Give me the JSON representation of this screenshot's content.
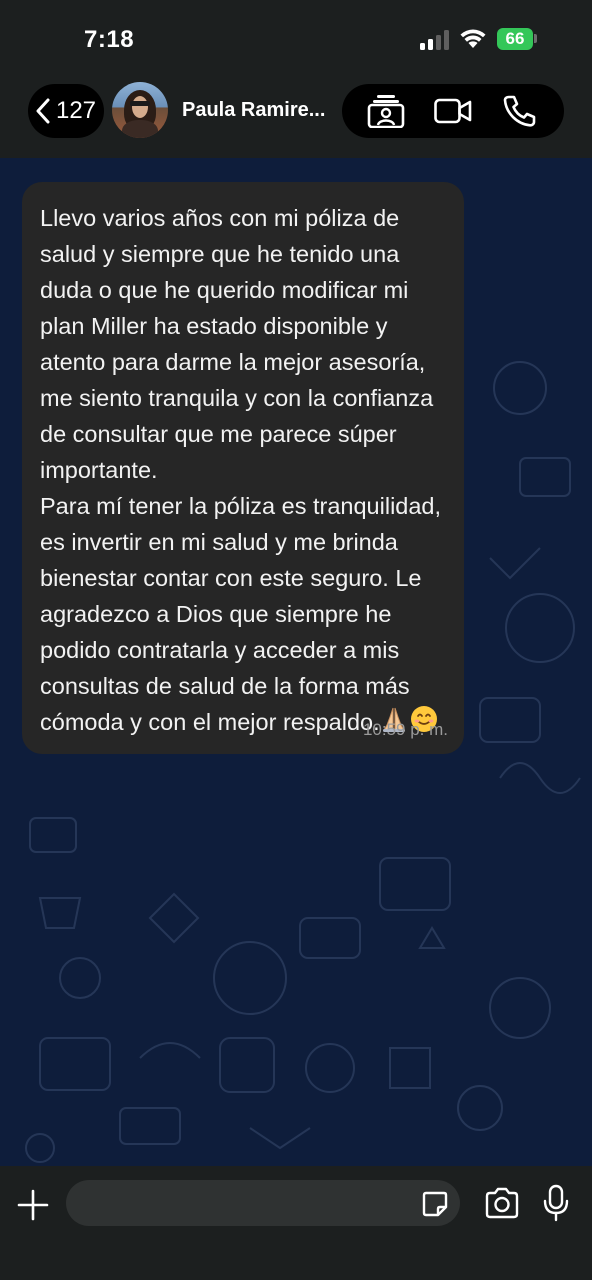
{
  "status_bar": {
    "time": "7:18",
    "battery": "66"
  },
  "header": {
    "back_count": "127",
    "contact_name": "Paula Ramire...",
    "icons": [
      "chevron-left-icon",
      "contact-card-icon",
      "video-call-icon",
      "phone-icon"
    ]
  },
  "message": {
    "text": "Llevo varios años con mi póliza de salud y siempre que he tenido una duda o que he querido modificar mi plan Miller ha estado disponible y atento para darme la mejor asesoría, me siento tranquila y con la confianza de consultar que me parece súper importante.\nPara mí tener la póliza es tranquilidad, es invertir en mi salud y me brinda bienestar contar con este seguro. Le agradezco a Dios que siempre he podido contratarla y acceder a mis consultas de salud de la forma más cómoda y con el mejor respaldo.",
    "emojis": [
      "praying-hands",
      "smiling-face"
    ],
    "time": "10:59 p. m."
  },
  "composer": {
    "placeholder": "",
    "icons": [
      "plus-icon",
      "sticker-icon",
      "camera-icon",
      "microphone-icon"
    ]
  },
  "colors": {
    "top_bar": "#1c1f1f",
    "chat_background": "#0e1d3b",
    "bubble": "#262626",
    "battery": "#34c759"
  }
}
